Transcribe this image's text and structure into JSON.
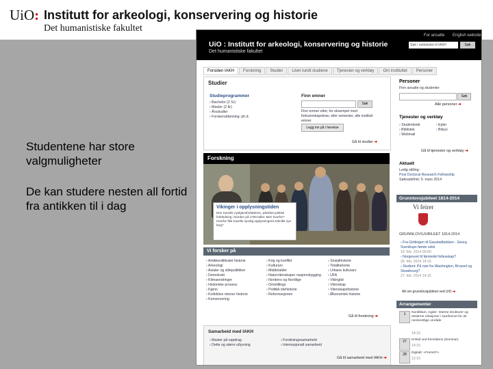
{
  "header": {
    "logo_text": "UiO",
    "logo_separator": ":",
    "institute": "Institutt for arkeologi, konservering og historie",
    "faculty": "Det humanistiske fakultet"
  },
  "slide_text": {
    "paragraph1": "Studentene har store valgmuligheter",
    "paragraph2": "De kan studere nesten all fortid fra antikken til i dag"
  },
  "screenshot": {
    "top_links": [
      "For ansatte",
      "English website"
    ],
    "site_title": "UiO : Institutt for arkeologi, konservering og historie",
    "site_faculty": "Det humanistiske fakultet",
    "search_placeholder": "Søk i nettstedet til IAKH",
    "search_button": "Søk",
    "tabs": [
      "Forsiden IAKH",
      "Forskning",
      "Studier",
      "Livet rundt studiene",
      "Tjenester og verktøy",
      "Om instituttet",
      "Personer"
    ],
    "studier": {
      "title": "Studier",
      "programs_title": "Studieprogrammer",
      "programs": [
        "Bachelor (2 Sr)",
        "Master (2 år)",
        "Årsstudier",
        "Forskerutdanning: ph.d."
      ],
      "find_title": "Finn emner",
      "find_button": "Søk",
      "find_desc": "Finn emner etter, for eksempel med forkunnskapskrav, eller semester, alle institutt emner",
      "archive_button": "Legg inn på i henvise",
      "more": "Gå til studier"
    },
    "personer": {
      "title": "Personer",
      "search_label": "Finn ansatte og studenter",
      "search_button": "Søk",
      "more": "Alle personer"
    },
    "tjenester": {
      "title": "Tjenester og verktøy",
      "items": [
        "Studentweb",
        "Bibliotek",
        "Webmail",
        "Epler",
        "Bilsys"
      ],
      "more": "Gå til tjenester og verktøy"
    },
    "aktuelt": {
      "title": "Aktuelt",
      "line1": "Ledig stilling:",
      "line2": "Post Doctoral Research Fellowship",
      "line3": "Søknadsfrist: 5. mars 2014"
    },
    "grunnlov": {
      "title": "Grunnlovsjubileet 1814-2014",
      "celebrate": "Vi feirer",
      "jubilee_text": "GRUNNLOVSJUBILEET 1814-2014",
      "items": [
        "Fra Göttingen til Gaustadbekken - Georg Sverdrups første vekk",
        "Norgesvet til førstedel fellesskap?",
        "Student: På rute fra Washington, Brussel og Strasbourg?"
      ],
      "dates": [
        "19. feb. 2014 00:00",
        "26. feb. 2014 14:15",
        "27. feb. 2014 14:15"
      ],
      "more": "Alt om grunnlovsjubileet ved UiO"
    },
    "forskning": {
      "title": "Forskning",
      "feature_title": "Vikinger i opplysningstiden",
      "feature_text": "Den Kavelle nyskjønsforfatteren, påvirket politisk forkledning i Norden på 1760 tallet. Men hvorfor? Hvorfor fikk Kavelle syndig opplysningens teknikk nye ferg?",
      "more": "Gå til forskning"
    },
    "vi_forsker": {
      "title": "Vi forsker på",
      "col1": [
        "Antikkenilittratet historie",
        "Arkeologi",
        "Asiater og stilepulitikker",
        "Demokrati",
        "Klimaendringer",
        "Historiske prosess",
        "Kjønn",
        "Kollektive minner historie",
        "Konservering"
      ],
      "col2": [
        "Krig og konflikt",
        "Kulturarv",
        "Middelalder",
        "Naturvitenskaper nasjonsbygging",
        "Nordens og Nordlige",
        "Omstillings",
        "Politikk idehistorie",
        "Reformasjonen"
      ],
      "col3": [
        "Sosialhistorie",
        "Totalitarisme",
        "Urbane kulturarv",
        "UFA",
        "Vikingtid",
        "Vitenskap",
        "Vitenskapshistorie",
        "Økonomisk historie"
      ]
    },
    "samarbeid": {
      "title": "Samarbeid med IAKH",
      "col1": [
        "Master på oppdrag",
        "Dette og større utlysning"
      ],
      "col2": [
        "Forskningssamarbeid",
        "Internasjonalt samarbeid"
      ],
      "more": "Gå til samarbeid med IAKH"
    },
    "arrangementer": {
      "title": "Arrangementer",
      "events": [
        {
          "day": "1",
          "text": "Nordiltiam, Agder: Interne strukturer og eksterne relasjoner i samfunnet for de nordvestlige område",
          "time": "14:15"
        },
        {
          "day": "27",
          "text": "Kristid ved fremtidens (Seminar)",
          "time": "14:15"
        },
        {
          "day": "28",
          "text": "Digitalt: «Fremst?»",
          "time": "12:15"
        }
      ]
    }
  }
}
